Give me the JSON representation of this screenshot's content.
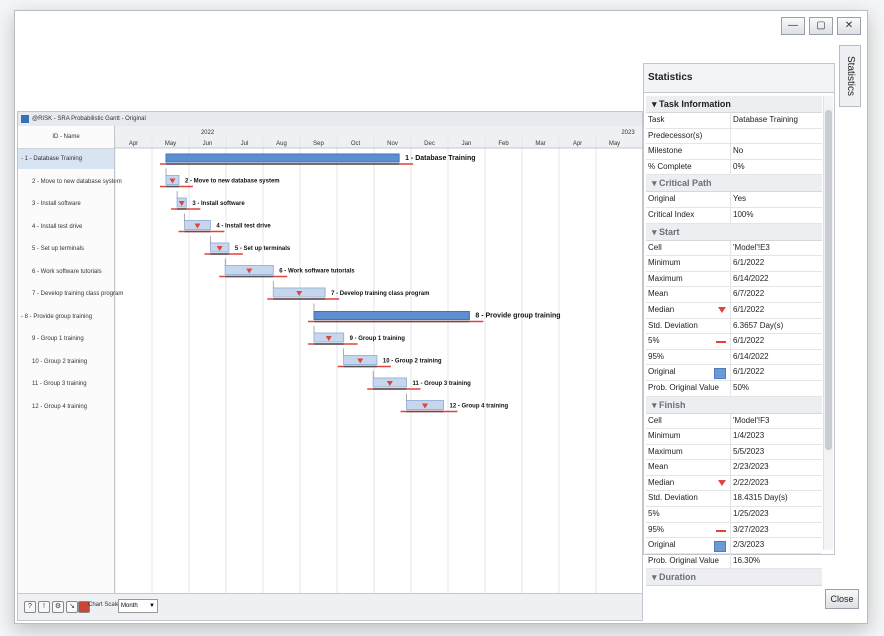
{
  "window": {
    "buttons": [
      "—",
      "▢",
      "✕"
    ],
    "side_tab": "Statistics",
    "close_label": "Close"
  },
  "gantt": {
    "title": "@RISK - SRA Probabilistic Gantt - Original",
    "id_header": "ID - Name",
    "years": [
      "2022",
      "2023"
    ],
    "months": [
      "Apr",
      "May",
      "Jun",
      "Jul",
      "Aug",
      "Sep",
      "Oct",
      "Nov",
      "Dec",
      "Jan",
      "Feb",
      "Mar",
      "Apr",
      "May"
    ],
    "tasks": [
      {
        "list": "- 1 - Database Training",
        "label": "1 - Database Training",
        "summary": true,
        "start": 1,
        "dur": 6.3
      },
      {
        "list": "2 - Move to new database system",
        "label": "2 - Move to new database system",
        "start": 1,
        "dur": 0.35
      },
      {
        "list": "3 - Install software",
        "label": "3 - Install software",
        "start": 1.3,
        "dur": 0.25
      },
      {
        "list": "4 - Install test drive",
        "label": "4 - Install test drive",
        "start": 1.5,
        "dur": 0.7
      },
      {
        "list": "5 - Set up terminals",
        "label": "5 - Set up terminals",
        "start": 2.2,
        "dur": 0.5
      },
      {
        "list": "6 - Work software tutorials",
        "label": "6 - Work software tutorials",
        "start": 2.6,
        "dur": 1.3
      },
      {
        "list": "7 - Develop training class program",
        "label": "7 - Develop training class program",
        "start": 3.9,
        "dur": 1.4
      },
      {
        "list": "- 8 - Provide group training",
        "label": "8 - Provide group training",
        "summary": true,
        "start": 5,
        "dur": 4.2
      },
      {
        "list": "9 - Group 1 training",
        "label": "9 - Group 1 training",
        "start": 5,
        "dur": 0.8
      },
      {
        "list": "10 - Group 2 training",
        "label": "10 - Group 2 training",
        "start": 5.8,
        "dur": 0.9
      },
      {
        "list": "11 - Group 3 training",
        "label": "11 - Group 3 training",
        "start": 6.6,
        "dur": 0.9
      },
      {
        "list": "12 - Group 4 training",
        "label": "12 - Group 4 training",
        "start": 7.5,
        "dur": 1.0
      }
    ],
    "chart_scale_label": "Chart Scale",
    "chart_scale_value": "Month",
    "toolbar_icons": [
      "help-icon",
      "warning-icon",
      "settings-icon",
      "connector-icon",
      "color-icon"
    ]
  },
  "stats": {
    "title": "Statistics",
    "sections": [
      {
        "title": "Task Information",
        "main": true,
        "rows": [
          {
            "k": "Task",
            "v": "Database Training"
          },
          {
            "k": "Predecessor(s)",
            "v": ""
          },
          {
            "k": "Milestone",
            "v": "No"
          },
          {
            "k": "% Complete",
            "v": "0%"
          }
        ]
      },
      {
        "title": "Critical Path",
        "rows": [
          {
            "k": "Original",
            "v": "Yes"
          },
          {
            "k": "Critical Index",
            "v": "100%"
          }
        ]
      },
      {
        "title": "Start",
        "rows": [
          {
            "k": "Cell",
            "v": "'Model'!E3"
          },
          {
            "k": "Minimum",
            "v": "6/1/2022"
          },
          {
            "k": "Maximum",
            "v": "6/14/2022"
          },
          {
            "k": "Mean",
            "v": "6/7/2022"
          },
          {
            "k": "Median",
            "v": "6/1/2022",
            "marker": "tri"
          },
          {
            "k": "Std. Deviation",
            "v": "6.3657 Day(s)"
          },
          {
            "k": "5%",
            "v": "6/1/2022",
            "marker": "line"
          },
          {
            "k": "95%",
            "v": "6/14/2022"
          },
          {
            "k": "Original",
            "v": "6/1/2022",
            "marker": "box"
          },
          {
            "k": "Prob. Original Value",
            "v": "50%"
          }
        ]
      },
      {
        "title": "Finish",
        "rows": [
          {
            "k": "Cell",
            "v": "'Model'!F3"
          },
          {
            "k": "Minimum",
            "v": "1/4/2023"
          },
          {
            "k": "Maximum",
            "v": "5/5/2023"
          },
          {
            "k": "Mean",
            "v": "2/23/2023"
          },
          {
            "k": "Median",
            "v": "2/22/2023",
            "marker": "tri"
          },
          {
            "k": "Std. Deviation",
            "v": "18.4315 Day(s)"
          },
          {
            "k": "5%",
            "v": "1/25/2023"
          },
          {
            "k": "95%",
            "v": "3/27/2023",
            "marker": "line"
          },
          {
            "k": "Original",
            "v": "2/3/2023",
            "marker": "box"
          },
          {
            "k": "Prob. Original Value",
            "v": "16.30%"
          }
        ]
      },
      {
        "title": "Duration",
        "rows": []
      }
    ]
  }
}
